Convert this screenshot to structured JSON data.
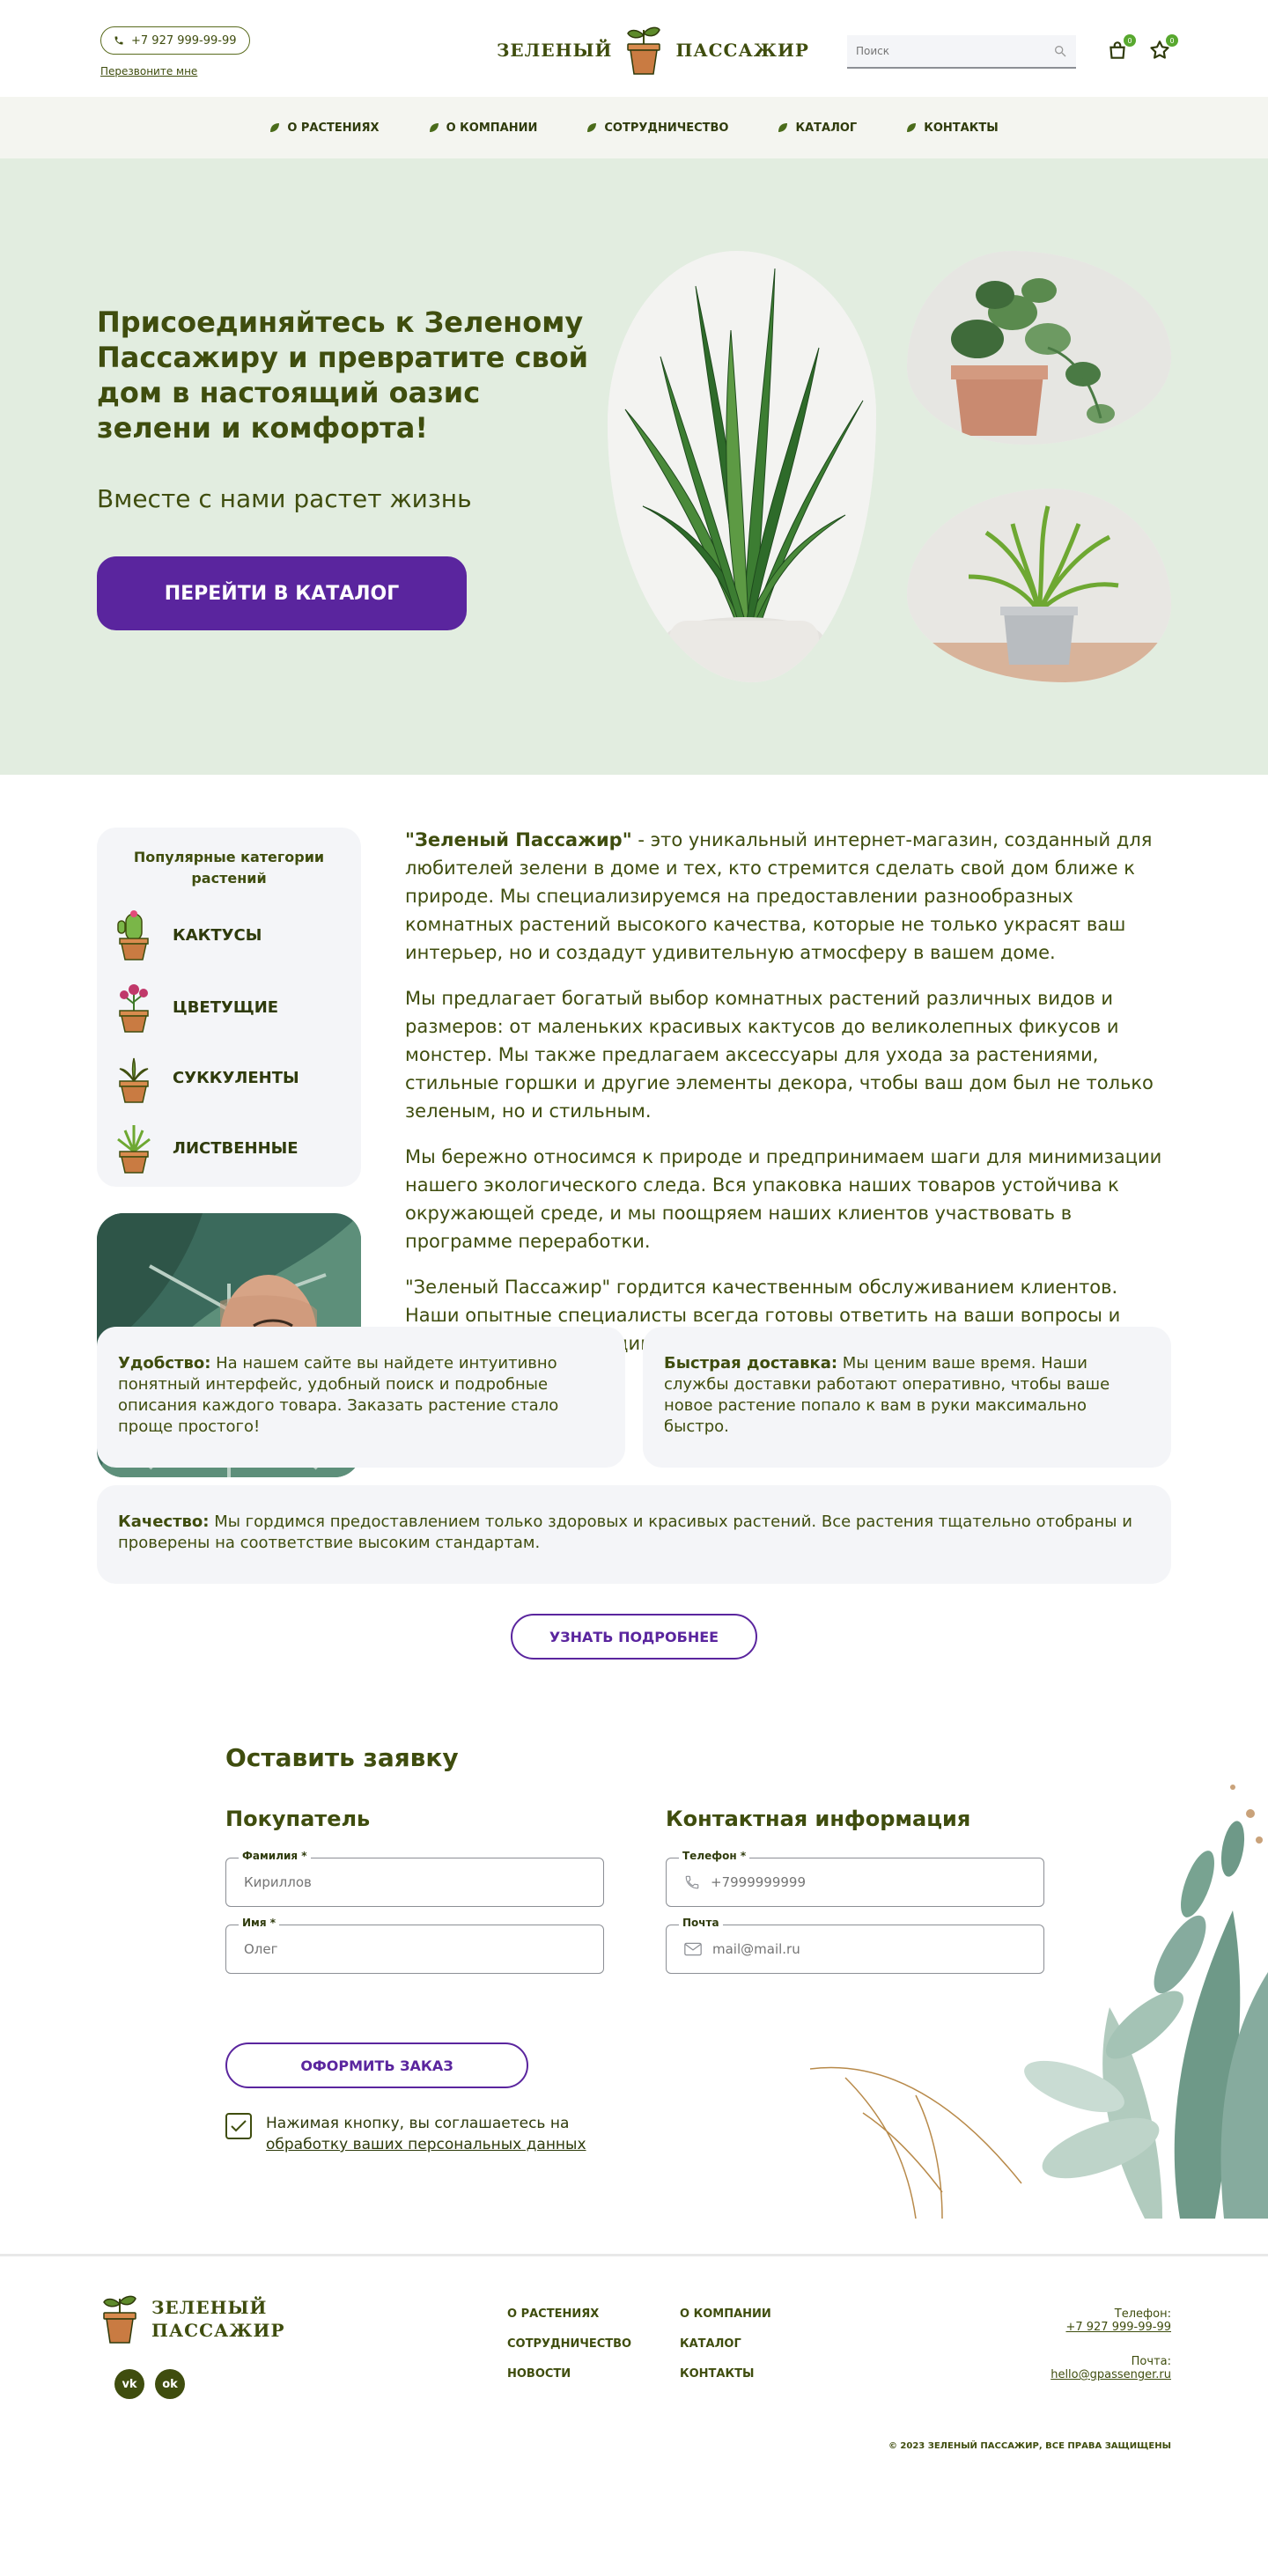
{
  "header": {
    "phone": "+7 927 999-99-99",
    "callback": "Перезвоните мне",
    "logo_left": "ЗЕЛЕНЫЙ",
    "logo_right": "ПАССАЖИР",
    "search_placeholder": "Поиск",
    "cart_count": "0",
    "fav_count": "0"
  },
  "nav": {
    "items": [
      "О РАСТЕНИЯХ",
      "О КОМПАНИИ",
      "СОТРУДНИЧЕСТВО",
      "КАТАЛОГ",
      "КОНТАКТЫ"
    ]
  },
  "hero": {
    "title": "Присоединяйтесь к Зеленому Пассажиру и превратите свой дом в настоящий оазис зелени и комфорта!",
    "subtitle": "Вместе с нами растет жизнь",
    "cta": "ПЕРЕЙТИ В КАТАЛОГ"
  },
  "categories": {
    "title": "Популярные категории растений",
    "items": [
      "КАКТУСЫ",
      "ЦВЕТУЩИЕ",
      "СУККУЛЕНТЫ",
      "ЛИСТВЕННЫЕ"
    ]
  },
  "about": {
    "brand": "\"Зеленый Пассажир\"",
    "p1_rest": " - это уникальный интернет-магазин, созданный для любителей зелени в доме и тех, кто стремится сделать свой дом ближе к природе. Мы специализируемся на предоставлении разнообразных комнатных растений высокого качества, которые не только украсят ваш интерьер, но и создадут удивительную атмосферу в вашем доме.",
    "p2": "Мы предлагает богатый выбор комнатных растений различных видов и размеров: от маленьких красивых кактусов до великолепных фикусов и монстер. Мы также предлагаем аксессуары для ухода за растениями, стильные горшки и другие элементы декора, чтобы ваш дом был не только зеленым, но и стильным.",
    "p3": "Мы бережно относимся к природе и предпринимаем шаги для минимизации нашего экологического следа. Вся упаковка наших товаров устойчива к окружающей среде, и мы поощряем наших клиентов участвовать в программе переработки.",
    "p4": "\"Зеленый Пассажир\" гордится качественным обслуживанием клиентов. Наши опытные специалисты всегда готовы ответить на ваши вопросы и предоставить необходимую информацию."
  },
  "features": {
    "f1_title": "Удобство:",
    "f1_text": " На нашем сайте вы найдете интуитивно понятный интерфейс, удобный поиск и подробные описания каждого товара. Заказать растение стало проще простого!",
    "f2_title": "Быстрая доставка:",
    "f2_text": " Мы ценим ваше время. Наши службы доставки работают оперативно, чтобы ваше новое растение попало к вам в руки максимально быстро.",
    "f3_title": "Качество:",
    "f3_text": " Мы гордимся предоставлением только здоровых и красивых растений. Все растения тщательно отобраны и проверены на соответствие высоким стандартам.",
    "more": "УЗНАТЬ ПОДРОБНЕЕ"
  },
  "form": {
    "title": "Оставить заявку",
    "buyer_title": "Покупатель",
    "contact_title": "Контактная информация",
    "surname_label": "Фамилия *",
    "surname_placeholder": "Кириллов",
    "name_label": "Имя *",
    "name_placeholder": "Олег",
    "phone_label": "Телефон *",
    "phone_placeholder": "+7999999999",
    "email_label": "Почта",
    "email_placeholder": "mail@mail.ru",
    "submit": "ОФОРМИТЬ ЗАКАЗ",
    "agree_text": "Нажимая кнопку, вы соглашаетесь на ",
    "agree_link": "обработку ваших персональных данных"
  },
  "footer": {
    "logo_line1": "ЗЕЛЕНЫЙ",
    "logo_line2": "ПАССАЖИР",
    "vk": "vk",
    "ok": "ok",
    "links_col1": [
      "О РАСТЕНИЯХ",
      "СОТРУДНИЧЕСТВО",
      "НОВОСТИ"
    ],
    "links_col2": [
      "О КОМПАНИИ",
      "КАТАЛОГ",
      "КОНТАКТЫ"
    ],
    "phone_label": "Телефон:",
    "phone": "+7 927 999-99-99",
    "email_label": "Почта:",
    "email": "hello@gpassenger.ru",
    "copyright": "© 2023 ЗЕЛЕНЫЙ ПАССАЖИР, ВСЕ ПРАВА ЗАЩИЩЕНЫ"
  },
  "colors": {
    "olive": "#3f4d0e",
    "purple": "#5a259e",
    "hero_bg": "#e2ede0",
    "card_bg": "#f4f5f8",
    "badge": "#58a82f"
  }
}
